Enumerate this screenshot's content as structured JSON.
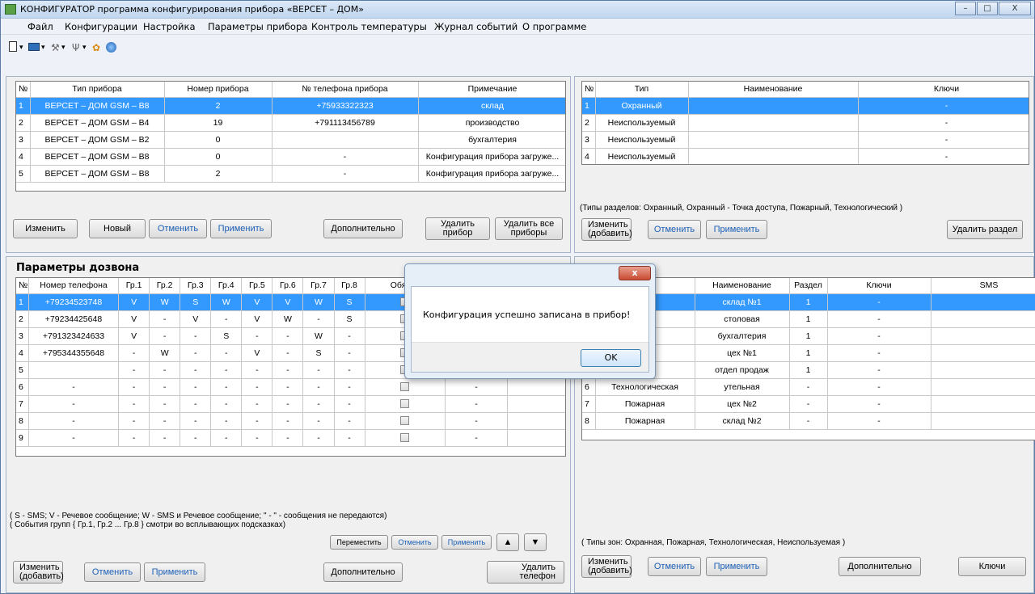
{
  "window": {
    "title": "КОНФИГУРАТОР программа конфигурирования прибора «ВЕРСЕТ – ДОМ»",
    "min": "–",
    "max": "□",
    "close": "X"
  },
  "menu": [
    "Файл",
    "Конфигурации",
    "Настройка",
    "Параметры прибора",
    "Контроль температуры",
    "Журнал событий",
    "О программе"
  ],
  "toolbar": {
    "new": "▾",
    "device": "▾",
    "tools": "▾",
    "usb": "▾"
  },
  "devices": {
    "headers": [
      "№",
      "Тип прибора",
      "Номер прибора",
      "№ телефона прибора",
      "Примечание"
    ],
    "rows": [
      [
        "1",
        "ВЕРСЕТ – ДОМ GSM – B8",
        "2",
        "+75933322323",
        "склад"
      ],
      [
        "2",
        "ВЕРСЕТ – ДОМ GSM – B4",
        "19",
        "+791113456789",
        "производство"
      ],
      [
        "3",
        "ВЕРСЕТ – ДОМ GSM – B2",
        "0",
        "",
        "бухгалтерия"
      ],
      [
        "4",
        "ВЕРСЕТ – ДОМ GSM – B8",
        "0",
        "-",
        "Конфигурация прибора загруже..."
      ],
      [
        "5",
        "ВЕРСЕТ – ДОМ GSM – B8",
        "2",
        "-",
        "Конфигурация прибора загруже..."
      ]
    ],
    "buttons": {
      "edit": "Изменить",
      "new": "Новый",
      "cancel": "Отменить",
      "apply": "Применить",
      "more": "Дополнительно",
      "delete1": "Удалить",
      "delete2": "прибор",
      "deleteall1": "Удалить все",
      "deleteall2": "приборы"
    }
  },
  "sections": {
    "headers": [
      "№",
      "Тип",
      "Наименование",
      "Ключи"
    ],
    "rows": [
      [
        "1",
        "Охранный",
        "",
        "-"
      ],
      [
        "2",
        "Неиспользуемый",
        "",
        "-"
      ],
      [
        "3",
        "Неиспользуемый",
        "",
        "-"
      ],
      [
        "4",
        "Неиспользуемый",
        "",
        "-"
      ]
    ],
    "note": "(Типы разделов: Охранный, Охранный - Точка доступа, Пожарный, Технологический )",
    "buttons": {
      "edit1": "Изменить",
      "edit2": "(добавить)",
      "cancel": "Отменить",
      "apply": "Применить",
      "delete": "Удалить раздел"
    }
  },
  "dial": {
    "title": "Параметры дозвона",
    "headers": [
      "№",
      "Номер телефона",
      "Гр.1",
      "Гр.2",
      "Гр.3",
      "Гр.4",
      "Гр.5",
      "Гр.6",
      "Гр.7",
      "Гр.8",
      "Обяз. д"
    ],
    "rows": [
      [
        "1",
        "+79234523748",
        "V",
        "W",
        "S",
        "W",
        "V",
        "V",
        "W",
        "S"
      ],
      [
        "2",
        "+79234425648",
        "V",
        "-",
        "V",
        "-",
        "V",
        "W",
        "-",
        "S"
      ],
      [
        "3",
        "+791323424633",
        "V",
        "-",
        "-",
        "S",
        "-",
        "-",
        "W",
        "-"
      ],
      [
        "4",
        "+795344355648",
        "-",
        "W",
        "-",
        "-",
        "V",
        "-",
        "S",
        "-"
      ],
      [
        "5",
        "",
        "-",
        "-",
        "-",
        "-",
        "-",
        "-",
        "-",
        "-"
      ],
      [
        "6",
        "-",
        "-",
        "-",
        "-",
        "-",
        "-",
        "-",
        "-",
        "-"
      ],
      [
        "7",
        "-",
        "-",
        "-",
        "-",
        "-",
        "-",
        "-",
        "-",
        "-"
      ],
      [
        "8",
        "-",
        "-",
        "-",
        "-",
        "-",
        "-",
        "-",
        "-",
        "-"
      ],
      [
        "9",
        "-",
        "-",
        "-",
        "-",
        "-",
        "-",
        "-",
        "-",
        "-"
      ]
    ],
    "extra": [
      "-",
      "-",
      "-",
      "-"
    ],
    "note1": "( S - SMS;  V - Речевое сообщение;  W - SMS и Речевое сообщение; \" - \" - сообщения не передаются)",
    "note2": "( События групп { Гр.1, Гр.2 ... Гр.8 } смотри во всплывающих подсказках)",
    "buttons": {
      "move": "Переместить",
      "cancel_s": "Отменить",
      "apply_s": "Применить",
      "up": "▲",
      "down": "▼",
      "edit1": "Изменить",
      "edit2": "(добавить)",
      "cancel": "Отменить",
      "apply": "Применить",
      "more": "Дополнительно",
      "del1": "Удалить",
      "del2": "телефон"
    }
  },
  "zones": {
    "headers": [
      "№",
      "Тип",
      "Наименование",
      "Раздел",
      "Ключи",
      "SMS"
    ],
    "rows": [
      [
        "1",
        "ая",
        "склад №1",
        "1",
        "-",
        ""
      ],
      [
        "2",
        "ая",
        "столовая",
        "1",
        "-",
        ""
      ],
      [
        "3",
        "ая",
        "бухгалтерия",
        "1",
        "-",
        ""
      ],
      [
        "4",
        "ая",
        "цех №1",
        "1",
        "-",
        ""
      ],
      [
        "5",
        "ая",
        "отдел продаж",
        "1",
        "-",
        ""
      ],
      [
        "6",
        "Технологическая",
        "утельная",
        "-",
        "-",
        ""
      ],
      [
        "7",
        "Пожарная",
        "цех №2",
        "-",
        "-",
        ""
      ],
      [
        "8",
        "Пожарная",
        "склад №2",
        "-",
        "-",
        ""
      ]
    ],
    "note": "( Типы зон: Охранная, Пожарная, Технологическая, Неиспользуемая )",
    "buttons": {
      "edit1": "Изменить",
      "edit2": "(добавить)",
      "cancel": "Отменить",
      "apply": "Применить",
      "more": "Дополнительно",
      "keys": "Ключи"
    }
  },
  "dialog": {
    "message": "Конфигурация успешно записана в прибор!",
    "ok": "OK",
    "close": "x"
  }
}
